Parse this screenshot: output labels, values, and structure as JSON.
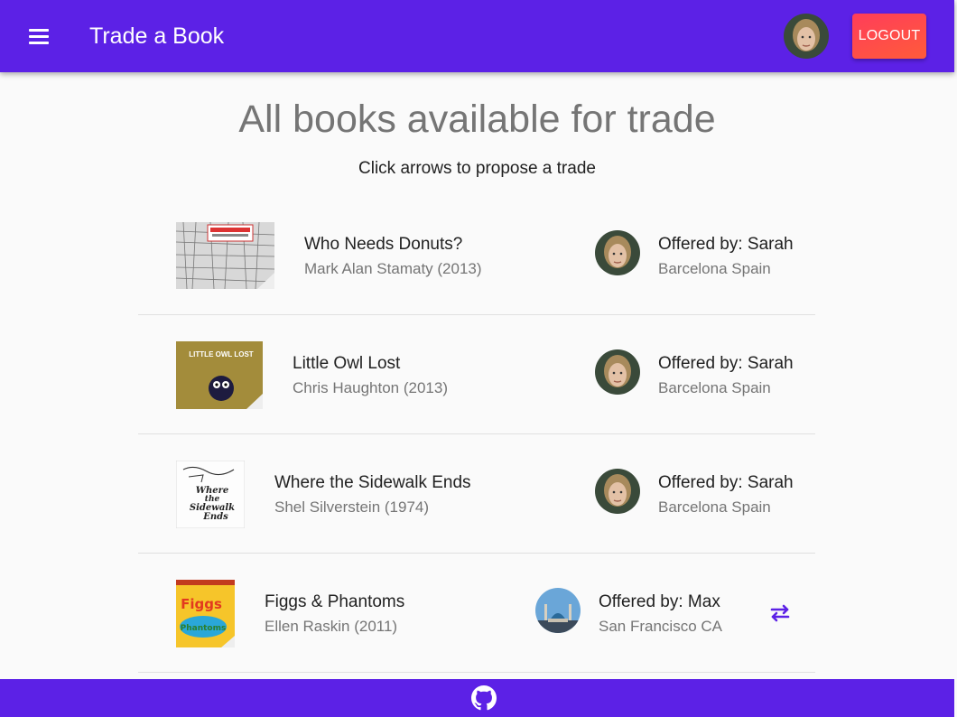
{
  "header": {
    "title": "Trade a Book",
    "logout_label": "LOGOUT",
    "menu_icon": "menu-icon",
    "brand_color": "#5c21e6",
    "logout_color": "#ff4a4a"
  },
  "main": {
    "heading": "All books available for trade",
    "subheading": "Click arrows to propose a trade"
  },
  "books": [
    {
      "title": "Who Needs Donuts?",
      "author": "Mark Alan Stamaty (2013)",
      "offered_by": "Offered by: Sarah",
      "location": "Barcelona Spain"
    },
    {
      "title": "Little Owl Lost",
      "author": "Chris Haughton (2013)",
      "offered_by": "Offered by: Sarah",
      "location": "Barcelona Spain"
    },
    {
      "title": "Where the Sidewalk Ends",
      "author": "Shel Silverstein (1974)",
      "offered_by": "Offered by: Sarah",
      "location": "Barcelona Spain"
    },
    {
      "title": "Figgs & Phantoms",
      "author": "Ellen Raskin (2011)",
      "offered_by": "Offered by: Max",
      "location": "San Francisco CA"
    }
  ],
  "covers": {
    "owl": "LITTLE OWL LOST",
    "sidewalk_line1": "Where",
    "sidewalk_line2": "the",
    "sidewalk_line3": "Sidewalk",
    "sidewalk_line4": "Ends",
    "figgs_line1": "Figgs",
    "figgs_line2": "Phantoms"
  },
  "icons": {
    "trade": "swap-arrows-icon",
    "footer": "github-icon"
  }
}
